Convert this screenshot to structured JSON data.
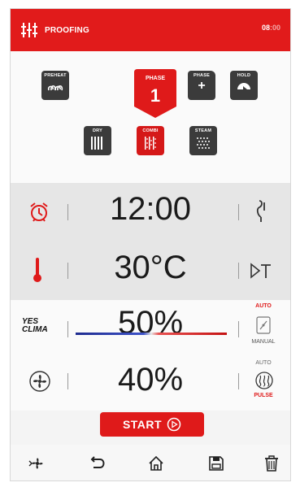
{
  "header": {
    "title": "PROOFING",
    "time_main": "08",
    "time_dim": ":00",
    "icon": "proofing-icon",
    "bg_color": "#e11b1b"
  },
  "modes": {
    "preheat_label": "PREHEAT",
    "phase_label": "PHASE",
    "phase_number": "1",
    "add_phase_label": "PHASE",
    "add_phase_symbol": "+",
    "hold_label": "HOLD",
    "dry_label": "DRY",
    "combi_label": "COMBI",
    "steam_label": "STEAM",
    "active_mode": "COMBI"
  },
  "rows": {
    "time": {
      "value": "12:00",
      "left_icon": "alarm-clock-icon",
      "right_icon": "core-probe-icon"
    },
    "temperature": {
      "value": "30°C",
      "left_icon": "thermometer-icon",
      "right_icon": "delta-t-icon"
    },
    "humidity": {
      "value": "50%",
      "left_label_top": "YES",
      "left_label_bottom": "CLIMA",
      "mode_top": "AUTO",
      "mode_bottom": "MANUAL",
      "right_icon": "humidity-manual-icon"
    },
    "fan": {
      "value": "40%",
      "left_icon": "fan-icon",
      "mode_top": "AUTO",
      "mode_bottom": "PULSE",
      "right_icon": "fan-pulse-icon"
    }
  },
  "start_button": {
    "label": "START"
  },
  "bottom_bar": {
    "items": [
      "fan-settings-icon",
      "back-icon",
      "home-icon",
      "save-icon",
      "delete-icon"
    ]
  },
  "colors": {
    "accent": "#df1a1a",
    "dark_tile": "#3b3b3b"
  }
}
